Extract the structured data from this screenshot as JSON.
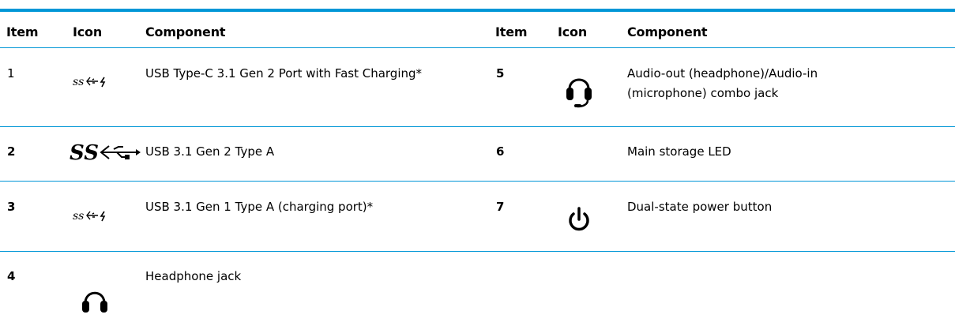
{
  "headers": [
    "Item",
    "Icon",
    "Component",
    "Item",
    "Icon",
    "Component"
  ],
  "rows": [
    {
      "left": {
        "item": "1",
        "icon": "superspeed-usb-charging-icon",
        "component": "USB Type-C 3.1 Gen 2 Port with Fast Charging*"
      },
      "right": {
        "item": "5",
        "icon": "headset-icon",
        "component_line1": "Audio-out (headphone)/Audio-in",
        "component_line2": "(microphone) combo jack"
      }
    },
    {
      "left": {
        "item": "2",
        "icon": "superspeed-usb-icon",
        "component": "USB 3.1 Gen 2 Type A"
      },
      "right": {
        "item": "6",
        "icon": "",
        "component": "Main storage LED"
      }
    },
    {
      "left": {
        "item": "3",
        "icon": "superspeed-usb-charging-icon",
        "component": "USB 3.1 Gen 1 Type A (charging port)*"
      },
      "right": {
        "item": "7",
        "icon": "power-icon",
        "component": "Dual-state power button"
      }
    },
    {
      "left": {
        "item": "4",
        "icon": "headphone-icon",
        "component": "Headphone jack"
      }
    }
  ],
  "colors": {
    "accent": "#0096d6"
  }
}
